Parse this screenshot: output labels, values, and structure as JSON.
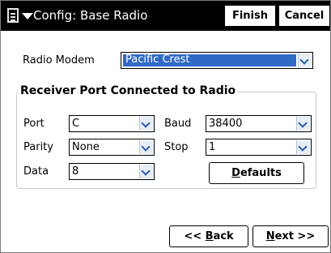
{
  "window": {
    "title": "Config: Base Radio"
  },
  "toolbar": {
    "finish_label": "Finish",
    "cancel_label": "Cancel"
  },
  "radio_modem": {
    "label": "Radio Modem",
    "value": "Pacific Crest"
  },
  "receiver_port": {
    "group_title": "Receiver Port Connected to Radio",
    "port": {
      "label": "Port",
      "value": "C"
    },
    "baud": {
      "label": "Baud",
      "value": "38400"
    },
    "parity": {
      "label": "Parity",
      "value": "None"
    },
    "stop": {
      "label": "Stop",
      "value": "1"
    },
    "data": {
      "label": "Data",
      "value": "8"
    },
    "defaults_button": {
      "prefix": "",
      "mnemonic": "D",
      "rest": "efaults"
    }
  },
  "navigation": {
    "back": {
      "prefix": "<< ",
      "mnemonic": "B",
      "rest": "ack"
    },
    "next": {
      "prefix": "",
      "mnemonic": "N",
      "rest": "ext >>"
    }
  },
  "icons": {
    "menu": "document-menu-icon",
    "dropdown": "chevron-down-icon"
  },
  "colors": {
    "titlebar": "#000000",
    "selection": "#3169c6"
  }
}
